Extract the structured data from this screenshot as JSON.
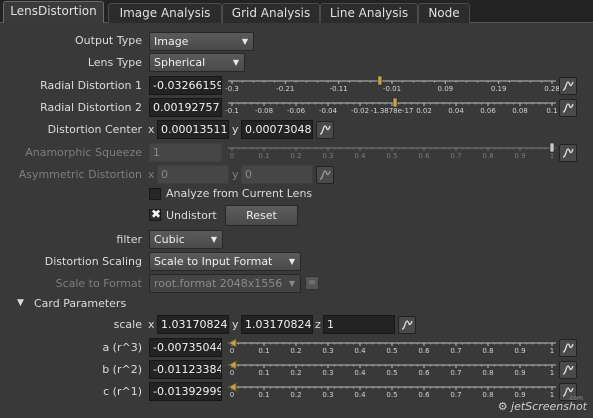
{
  "tabs": [
    "LensDistortion",
    "Image Analysis",
    "Grid Analysis",
    "Line Analysis",
    "Node"
  ],
  "fields": {
    "output_type": {
      "label": "Output Type",
      "value": "Image"
    },
    "lens_type": {
      "label": "Lens Type",
      "value": "Spherical"
    },
    "radial1": {
      "label": "Radial Distortion 1",
      "value": "-0.03266159",
      "ticks": [
        "-0.3",
        "-0.21",
        "-0.11",
        "-0.01",
        "0.09",
        "0.19",
        "0.28"
      ],
      "knob": -0.0327,
      "range": [
        -0.31,
        0.29
      ]
    },
    "radial2": {
      "label": "Radial Distortion 2",
      "value": "0.00192757",
      "ticks": [
        "-0.1",
        "-0.08",
        "-0.06",
        "-0.04",
        "-0.02",
        "-1.3878e-17",
        "0.02",
        "0.04",
        "0.06",
        "0.08",
        "0.1"
      ],
      "knob": 0.0019,
      "range": [
        -0.1,
        0.1
      ]
    },
    "center": {
      "label": "Distortion Center",
      "x_label": "x",
      "x": "0.00013511",
      "y_label": "y",
      "y": "0.00073048"
    },
    "anamorphic": {
      "label": "Anamorphic Squeeze",
      "value": "1",
      "ticks": [
        "0",
        "0.1",
        "0.2",
        "0.3",
        "0.4",
        "0.5",
        "0.6",
        "0.7",
        "0.8",
        "0.9",
        "1"
      ],
      "knob": 1
    },
    "asymmetric": {
      "label": "Asymmetric Distortion",
      "x_label": "x",
      "x": "0",
      "y_label": "y",
      "y": "0"
    },
    "analyze": {
      "label": "Analyze from Current Lens",
      "checked": false
    },
    "undistort": {
      "label": "Undistort",
      "checked": true
    },
    "reset": "Reset",
    "filter": {
      "label": "filter",
      "value": "Cubic"
    },
    "scaling": {
      "label": "Distortion Scaling",
      "value": "Scale to Input Format"
    },
    "scale_format": {
      "label": "Scale to Format",
      "value": "root.format 2048x1556",
      "eq": "="
    }
  },
  "card": {
    "header": "Card Parameters",
    "scale": {
      "label": "scale",
      "x_label": "x",
      "x": "1.03170824",
      "y_label": "y",
      "y": "1.03170824",
      "z_label": "z",
      "z": "1"
    },
    "a": {
      "label": "a (r^3)",
      "value": "-0.00735044",
      "ticks": [
        "0",
        "0.1",
        "0.2",
        "0.3",
        "0.4",
        "0.5",
        "0.6",
        "0.7",
        "0.8",
        "0.9",
        "1"
      ],
      "knob": -0.00735
    },
    "b": {
      "label": "b (r^2)",
      "value": "-0.01123384",
      "ticks": [
        "0",
        "0.1",
        "0.2",
        "0.3",
        "0.4",
        "0.5",
        "0.6",
        "0.7",
        "0.8",
        "0.9",
        "1"
      ],
      "knob": -0.01123
    },
    "c": {
      "label": "c (r^1)",
      "value": "-0.01392999",
      "ticks": [
        "0",
        "0.1",
        "0.2",
        "0.3",
        "0.4",
        "0.5",
        "0.6",
        "0.7",
        "0.8",
        "0.9",
        "1"
      ],
      "knob": -0.01393
    }
  },
  "icons": {
    "dropdown": "triangle-down-icon",
    "curve": "curve-icon",
    "collapse": "triangle-down-icon"
  },
  "watermark": {
    "text": "jetScreenshot",
    "suffix": ".com"
  }
}
